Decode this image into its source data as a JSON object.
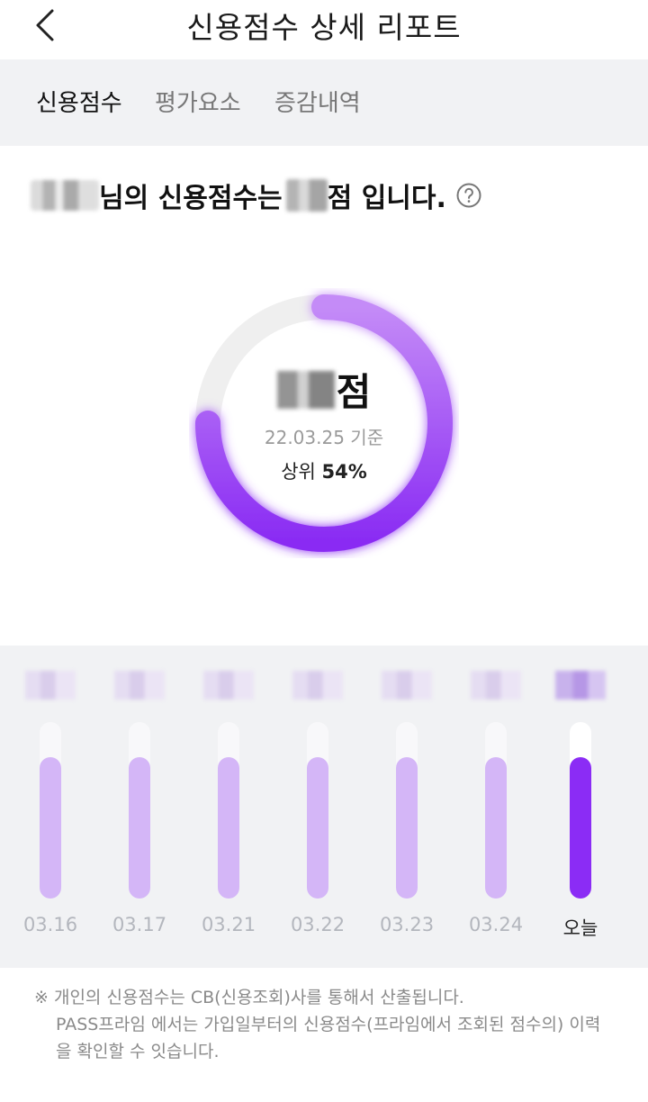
{
  "header": {
    "title": "신용점수 상세 리포트",
    "back_icon": "chevron-left-icon"
  },
  "tabs": [
    {
      "label": "신용점수",
      "active": true
    },
    {
      "label": "평가요소",
      "active": false
    },
    {
      "label": "증감내역",
      "active": false
    }
  ],
  "summary": {
    "suffix_name": "님의 신용점수는",
    "score_suffix": "점 입니다.",
    "help_icon": "question-circle-icon"
  },
  "gauge": {
    "score_unit": "점",
    "date_basis": "22.03.25 기준",
    "rank_prefix": "상위 ",
    "rank_value": "54%",
    "progress": 0.75,
    "colors": {
      "track": "#efefef",
      "start": "#c48bf7",
      "end": "#8a2cf3"
    }
  },
  "history": [
    {
      "date": "03.16",
      "level": 0.8,
      "today": false
    },
    {
      "date": "03.17",
      "level": 0.8,
      "today": false
    },
    {
      "date": "03.21",
      "level": 0.8,
      "today": false
    },
    {
      "date": "03.22",
      "level": 0.8,
      "today": false
    },
    {
      "date": "03.23",
      "level": 0.8,
      "today": false
    },
    {
      "date": "03.24",
      "level": 0.8,
      "today": false
    },
    {
      "date": "오늘",
      "level": 0.8,
      "today": true
    }
  ],
  "notice": {
    "line1": "※ 개인의 신용점수는 CB(신용조회)사를 통해서 산출됩니다.",
    "line2": "PASS프라임 에서는 가입일부터의 신용점수(프라임에서 조회된 점수의) 이력",
    "line3": "을 확인할 수 잇습니다."
  }
}
